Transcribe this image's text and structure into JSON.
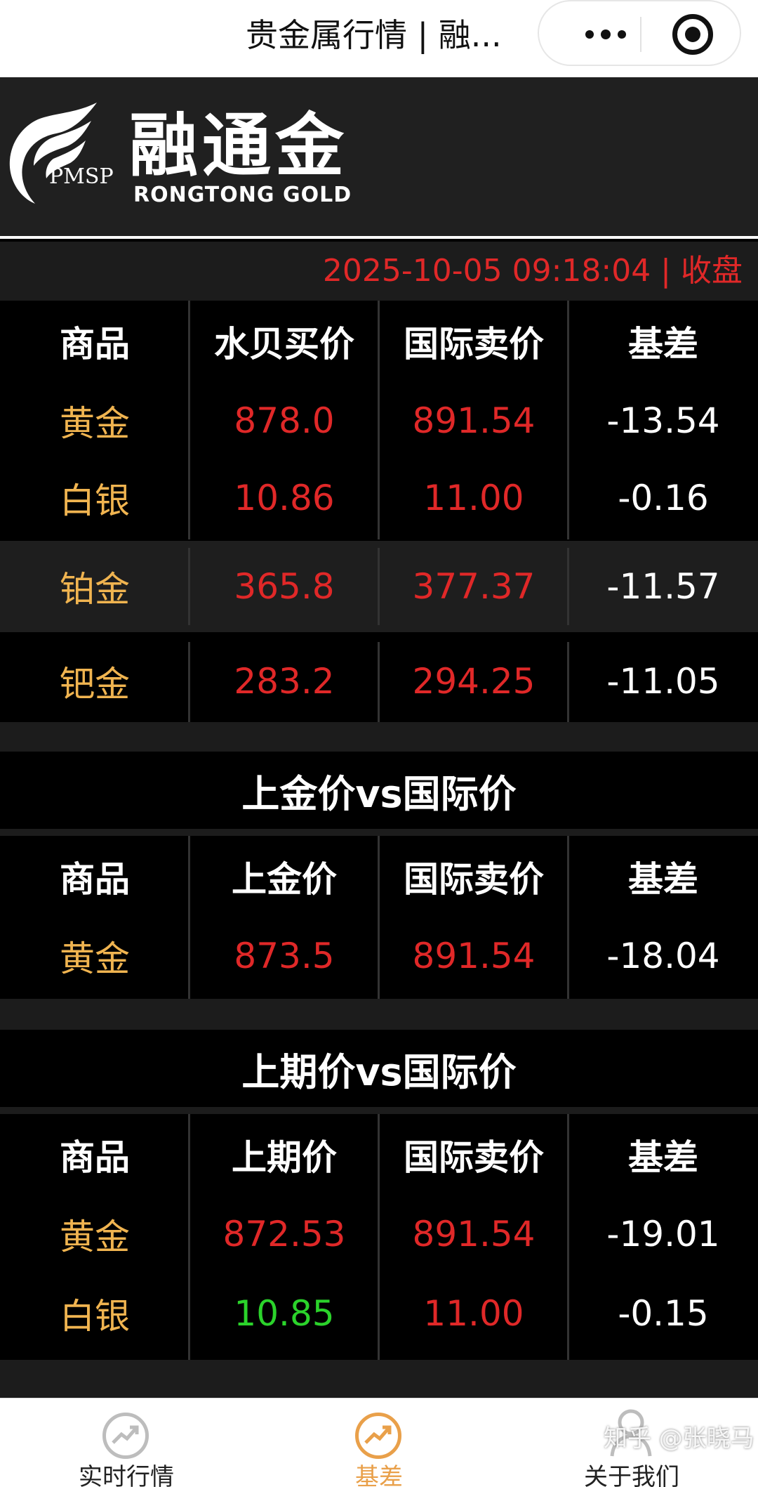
{
  "topbar": {
    "title": "贵金属行情 | 融..."
  },
  "header": {
    "logo_cn": "融通金",
    "logo_en": "RONGTONG GOLD",
    "logo_abbr": "PMSP"
  },
  "status": {
    "datetime": "2025-10-05 09:18:04",
    "state": "收盘",
    "text": "2025-10-05 09:18:04 | 收盘"
  },
  "table1": {
    "headers": [
      "商品",
      "水贝买价",
      "国际卖价",
      "基差"
    ],
    "rows": [
      {
        "name": "黄金",
        "local": "878.0",
        "intl": "891.54",
        "basis": "-13.54"
      },
      {
        "name": "白银",
        "local": "10.86",
        "intl": "11.00",
        "basis": "-0.16"
      },
      {
        "name": "铂金",
        "local": "365.8",
        "intl": "377.37",
        "basis": "-11.57"
      },
      {
        "name": "钯金",
        "local": "283.2",
        "intl": "294.25",
        "basis": "-11.05"
      }
    ]
  },
  "section2": {
    "title": "上金价vs国际价",
    "headers": [
      "商品",
      "上金价",
      "国际卖价",
      "基差"
    ],
    "rows": [
      {
        "name": "黄金",
        "local": "873.5",
        "intl": "891.54",
        "basis": "-18.04"
      }
    ]
  },
  "section3": {
    "title": "上期价vs国际价",
    "headers": [
      "商品",
      "上期价",
      "国际卖价",
      "基差"
    ],
    "rows": [
      {
        "name": "黄金",
        "local": "872.53",
        "intl": "891.54",
        "basis": "-19.01"
      },
      {
        "name": "白银",
        "local": "10.85",
        "intl": "11.00",
        "basis": "-0.15"
      }
    ]
  },
  "tabbar": {
    "tabs": [
      {
        "label": "实时行情",
        "icon": "chart-icon"
      },
      {
        "label": "基差",
        "icon": "trend-icon",
        "active": true
      },
      {
        "label": "关于我们",
        "icon": "user-icon"
      }
    ]
  },
  "watermark": "知乎 @张晓马",
  "colors": {
    "name": "#f0b450",
    "price": "#e02828",
    "up": "#2bd32b",
    "accent": "#e9a04a"
  }
}
